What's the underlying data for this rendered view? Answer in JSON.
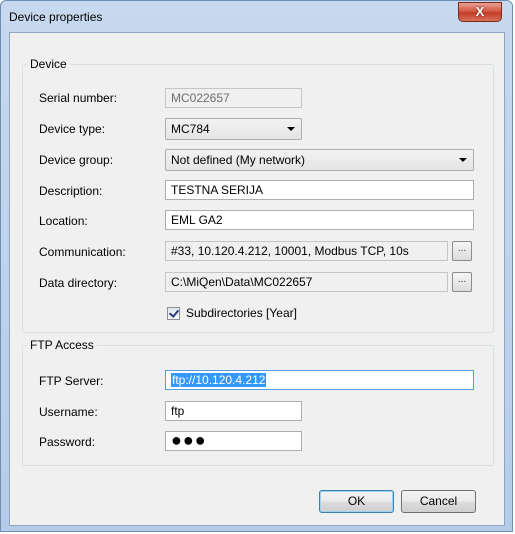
{
  "window": {
    "title": "Device properties",
    "close_glyph": "X"
  },
  "device": {
    "legend": "Device",
    "serial_label": "Serial number:",
    "serial_value": "MC022657",
    "type_label": "Device type:",
    "type_value": "MC784",
    "group_label": "Device group:",
    "group_value": "Not defined (My network)",
    "description_label": "Description:",
    "description_value": "TESTNA SERIJA",
    "location_label": "Location:",
    "location_value": "EML GA2",
    "communication_label": "Communication:",
    "communication_value": "#33, 10.120.4.212, 10001, Modbus TCP, 10s",
    "communication_button": "...",
    "data_dir_label": "Data directory:",
    "data_dir_value": "C:\\MiQen\\Data\\MC022657",
    "data_dir_button": "...",
    "subdirs_label": "Subdirectories [Year]",
    "subdirs_checked": true
  },
  "ftp": {
    "legend": "FTP Access",
    "server_label": "FTP Server:",
    "server_value": "ftp://10.120.4.212",
    "username_label": "Username:",
    "username_value": "ftp",
    "password_label": "Password:",
    "password_mask": "●●●"
  },
  "buttons": {
    "ok": "OK",
    "cancel": "Cancel"
  }
}
